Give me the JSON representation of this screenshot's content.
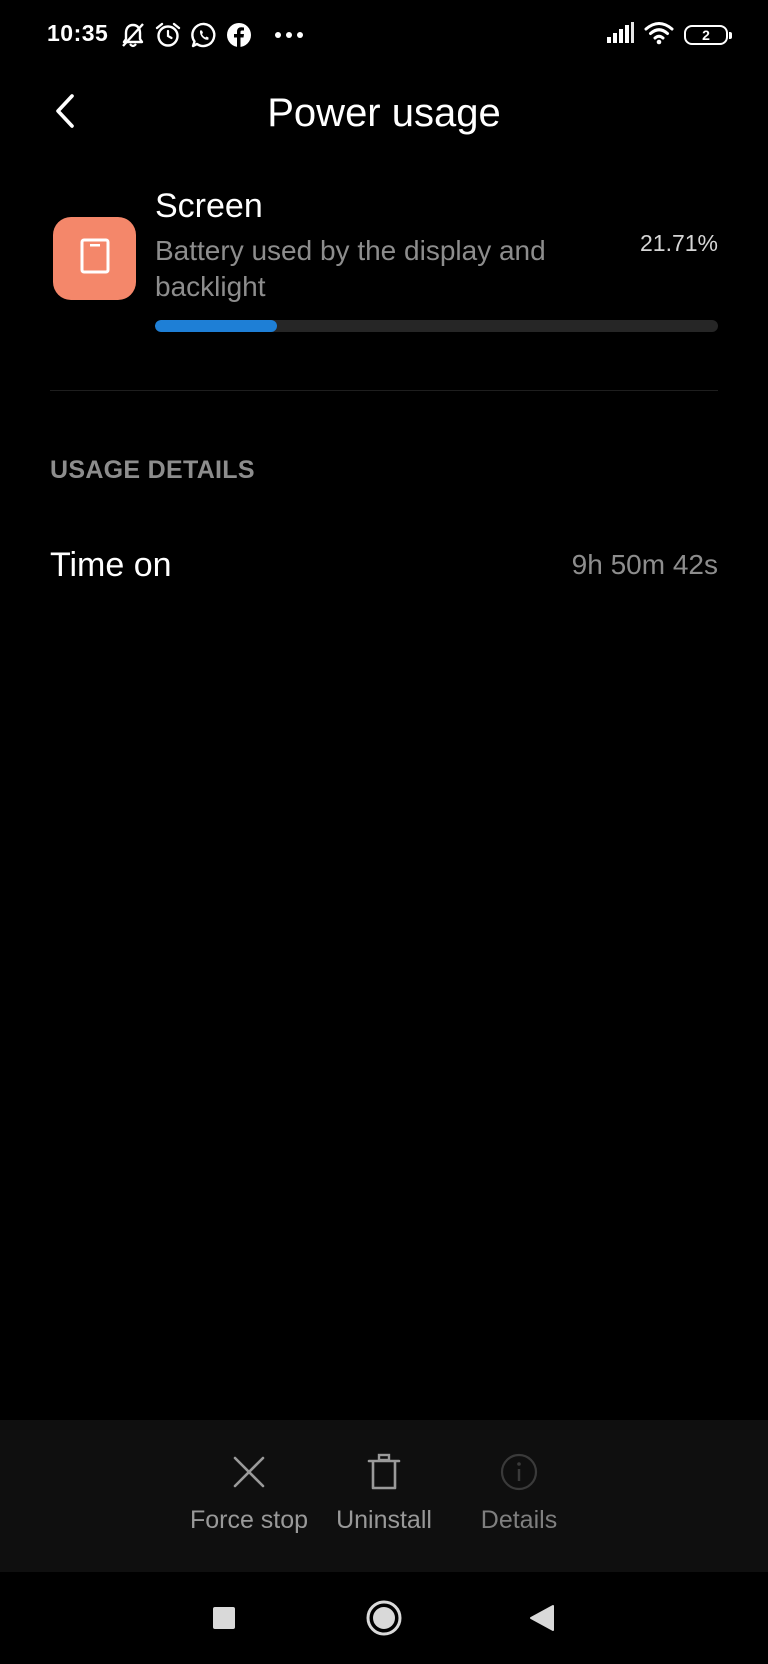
{
  "status_bar": {
    "time": "10:35",
    "left_icons": [
      "bell-off-icon",
      "alarm-icon",
      "whatsapp-icon",
      "facebook-icon",
      "more-dots-icon"
    ],
    "right_icons": [
      "signal-icon",
      "wifi-icon",
      "battery-icon"
    ],
    "battery_level": "2"
  },
  "header": {
    "title": "Power usage",
    "back_icon": "back-arrow-icon"
  },
  "app": {
    "icon": "tablet-screen-icon",
    "icon_color": "#f4876a",
    "name": "Screen",
    "description": "Battery used by the display and backlight",
    "percent": "21.71%",
    "usage_fraction": 0.2171,
    "bar_color": "#1e7fd6"
  },
  "usage_details": {
    "header": "USAGE DETAILS",
    "rows": [
      {
        "label": "Time on",
        "value": "9h 50m 42s"
      }
    ]
  },
  "actions": [
    {
      "label": "Force stop",
      "icon": "close-icon",
      "enabled": true
    },
    {
      "label": "Uninstall",
      "icon": "trash-icon",
      "enabled": true
    },
    {
      "label": "Details",
      "icon": "info-icon",
      "enabled": false
    }
  ],
  "nav_bar": {
    "buttons": [
      "recents-square-icon",
      "home-circle-icon",
      "back-triangle-icon"
    ]
  }
}
